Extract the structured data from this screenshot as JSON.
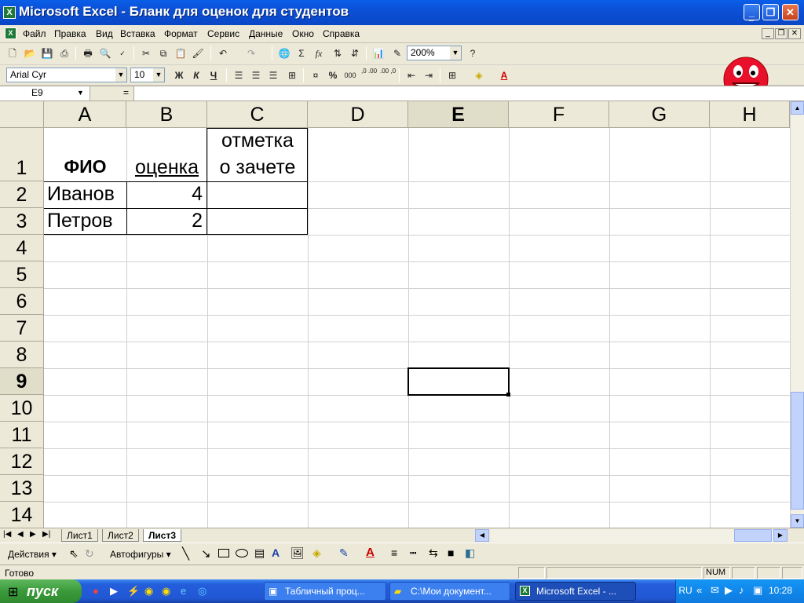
{
  "window": {
    "title": "Microsoft Excel - Бланк для оценок для студентов",
    "app_icon": "X"
  },
  "menu": [
    "Файл",
    "Правка",
    "Вид",
    "Вставка",
    "Формат",
    "Сервис",
    "Данные",
    "Окно",
    "Справка"
  ],
  "toolbar": {
    "zoom": "200%",
    "font_name": "Arial Cyr",
    "font_size": "10",
    "bold": "Ж",
    "italic": "К",
    "underline": "Ч",
    "sum": "Σ",
    "fx": "fx",
    "percent": "%",
    "thousands": "000",
    "inc_dec": ",0 .00",
    "dec_dec": ".00 ,0"
  },
  "formula_bar": {
    "name_box": "E9",
    "equals": "=",
    "content": ""
  },
  "columns": [
    "A",
    "B",
    "C",
    "D",
    "E",
    "F",
    "G",
    "H"
  ],
  "rows": [
    "1",
    "2",
    "3",
    "4",
    "5",
    "6",
    "7",
    "8",
    "9",
    "10",
    "11",
    "12",
    "13",
    "14"
  ],
  "cells": {
    "A1": "ФИО",
    "B1": "оценка",
    "C1_line1": "отметка",
    "C1_line2": "о зачете",
    "A2": "Иванов",
    "B2": "4",
    "A3": "Петров",
    "B3": "2"
  },
  "selected_cell": "E9",
  "sheets": [
    {
      "name": "Лист1",
      "active": false
    },
    {
      "name": "Лист2",
      "active": false
    },
    {
      "name": "Лист3",
      "active": true
    }
  ],
  "draw_toolbar": {
    "actions": "Действия",
    "autoshapes": "Автофигуры"
  },
  "status": {
    "text": "Готово",
    "num": "NUM"
  },
  "taskbar": {
    "start": "пуск",
    "buttons": [
      {
        "label": "Табличный проц...",
        "active": false
      },
      {
        "label": "C:\\Мои документ...",
        "active": false
      },
      {
        "label": "Microsoft Excel - ...",
        "active": true
      }
    ],
    "lang": "RU",
    "clock": "10:28"
  },
  "colors": {
    "title_bar": "#0b50d6",
    "start_green": "#3a9a3a",
    "taskbar_blue": "#245edb",
    "grid_line": "#d0d0d0"
  }
}
